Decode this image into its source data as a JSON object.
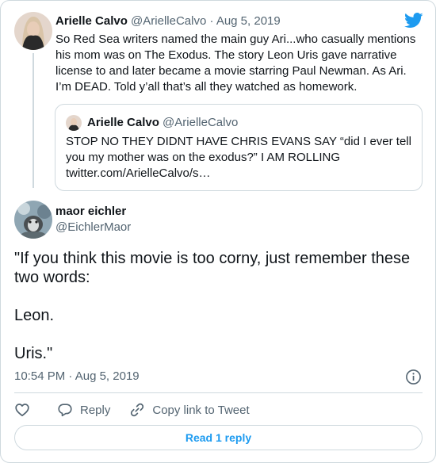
{
  "colors": {
    "twitter_blue": "#1d9bf0",
    "text_primary": "#0f1419",
    "text_secondary": "#536471",
    "border": "#cfd9de"
  },
  "icons": {
    "brand": "twitter-bird-icon",
    "info": "info-icon",
    "like": "heart-icon",
    "reply": "reply-bubble-icon",
    "copy": "link-icon"
  },
  "parent_tweet": {
    "author_name": "Arielle Calvo",
    "author_handle": "@ArielleCalvo",
    "separator": "·",
    "date": "Aug 5, 2019",
    "text": "So Red Sea writers named the main guy Ari...who casually mentions his mom was on The Exodus. The story Leon Uris gave narrative license to and later became a movie starring Paul Newman. As Ari. I’m DEAD. Told y’all that’s all they watched as homework.",
    "quoted": {
      "author_name": "Arielle Calvo",
      "author_handle": "@ArielleCalvo",
      "text": "STOP NO THEY DIDNT HAVE CHRIS EVANS SAY “did I ever tell you my mother was on the exodus?” I AM ROLLING twitter.com/ArielleCalvo/s…"
    }
  },
  "main_tweet": {
    "author_name": "maor eichler",
    "author_handle": "@EichlerMaor",
    "lines": [
      "\"If you think this movie is too corny, just remember these two words:",
      "Leon.",
      "Uris.\""
    ],
    "time": "10:54 PM",
    "separator": "·",
    "date": "Aug 5, 2019"
  },
  "actions": {
    "reply_label": "Reply",
    "copy_label": "Copy link to Tweet",
    "read_replies_label": "Read 1 reply"
  }
}
